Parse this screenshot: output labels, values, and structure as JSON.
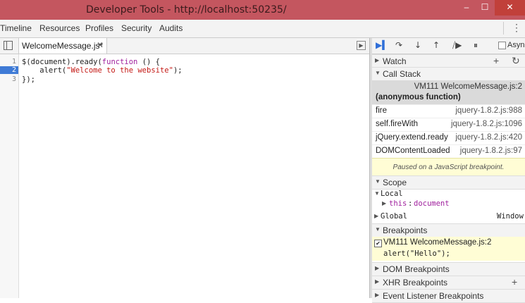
{
  "window": {
    "title": "Developer Tools - http://localhost:50235/",
    "minimize": "–",
    "maximize": "☐",
    "close": "✕"
  },
  "tabs": [
    "Timeline",
    "Resources",
    "Profiles",
    "Security",
    "Audits"
  ],
  "menu_icon": "⋮",
  "editor": {
    "file_tab": "WelcomeMessage.js*",
    "close_tab": "✕",
    "line_numbers": [
      "1",
      "2",
      "3"
    ],
    "active_line": "2",
    "code": {
      "l1_a": "$(document).ready(",
      "l1_kw": "function",
      "l1_b": " () {",
      "l2_a": "    alert(",
      "l2_str": "\"Welcome to the website\"",
      "l2_b": ");",
      "l3": "});"
    }
  },
  "debugger": {
    "toolbar_icons": [
      "resume-icon",
      "step-over-icon",
      "step-into-icon",
      "step-out-icon",
      "deactivate-breakpoints-icon",
      "pause-on-exceptions-icon"
    ],
    "async_label": "Asyn",
    "watch": {
      "label": "Watch",
      "add": "+",
      "refresh": "↻"
    },
    "call_stack": {
      "label": "Call Stack",
      "selected_location": "VM111 WelcomeMessage.js:2",
      "selected_function": "(anonymous function)",
      "frames": [
        {
          "fn": "fire",
          "loc": "jquery-1.8.2.js:988"
        },
        {
          "fn": "self.fireWith",
          "loc": "jquery-1.8.2.js:1096"
        },
        {
          "fn": "jQuery.extend.ready",
          "loc": "jquery-1.8.2.js:420"
        },
        {
          "fn": "DOMContentLoaded",
          "loc": "jquery-1.8.2.js:97"
        }
      ]
    },
    "paused_message": "Paused on a JavaScript breakpoint.",
    "scope": {
      "label": "Scope",
      "local_label": "Local",
      "this_key": "this",
      "this_value": "document",
      "global_label": "Global",
      "global_value": "Window"
    },
    "breakpoints": {
      "label": "Breakpoints",
      "location": "VM111 WelcomeMessage.js:2",
      "code": "alert(\"Hello\");"
    },
    "dom_breakpoints": "DOM Breakpoints",
    "xhr_breakpoints": {
      "label": "XHR Breakpoints",
      "add": "+"
    },
    "event_listener_breakpoints": "Event Listener Breakpoints"
  }
}
